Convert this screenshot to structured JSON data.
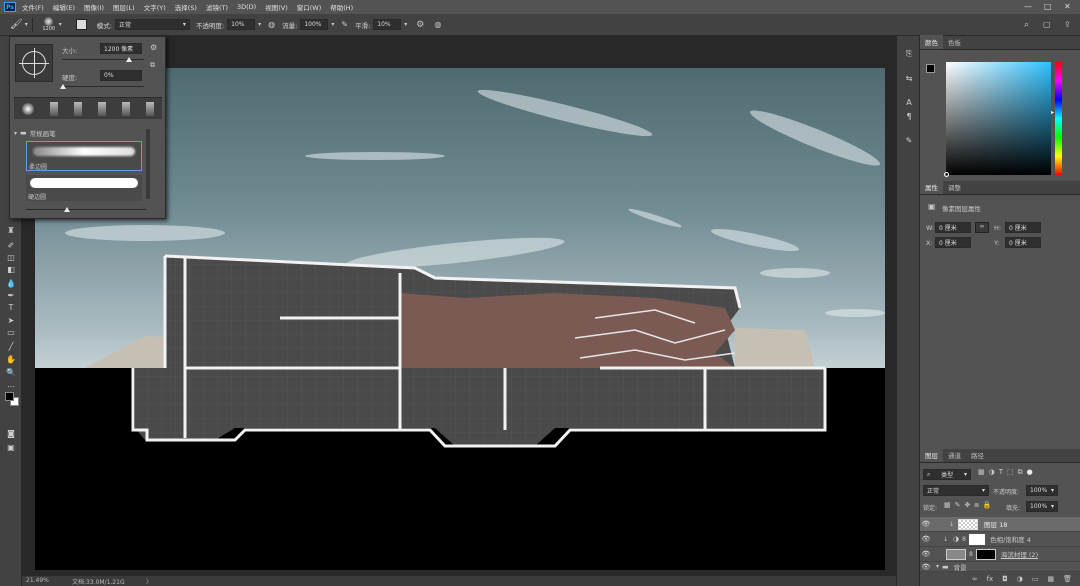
{
  "menu": {
    "items": [
      "文件(F)",
      "编辑(E)",
      "图像(I)",
      "图层(L)",
      "文字(Y)",
      "选择(S)",
      "滤镜(T)",
      "3D(D)",
      "视图(V)",
      "窗口(W)",
      "帮助(H)"
    ]
  },
  "window_controls": {
    "minimize": "—",
    "maximize": "□",
    "close": "✕"
  },
  "options": {
    "brush_size": "1200",
    "mode_label": "模式:",
    "mode_value": "正常",
    "opacity_label": "不透明度:",
    "opacity_value": "10%",
    "flow_label": "流量:",
    "flow_value": "100%",
    "smooth_label": "平滑:",
    "smooth_value": "10%"
  },
  "brush_panel": {
    "size_label": "大小:",
    "size_value": "1200 像素",
    "hardness_label": "硬度:",
    "hardness_value": "0%",
    "group_name": "常规画笔",
    "brush1_name": "柔边圆",
    "brush2_name": "硬边圆"
  },
  "status": {
    "zoom": "21.49%",
    "doc": "文档:33.0M/1.21G",
    "arrow": "〉"
  },
  "color_panel": {
    "tabs": [
      "颜色",
      "色板"
    ]
  },
  "properties": {
    "tabs": [
      "属性",
      "调整"
    ],
    "title": "像素图层属性",
    "w_label": "W:",
    "w_value": "0 厘米",
    "h_label": "H:",
    "h_value": "0 厘米",
    "x_label": "X:",
    "x_value": "0 厘米",
    "y_label": "Y:",
    "y_value": "0 厘米",
    "link_icon_text": "∞"
  },
  "layers_panel": {
    "tabs": [
      "图层",
      "通道",
      "路径"
    ],
    "kind_filter": "类型",
    "blend_mode": "正常",
    "opacity_label": "不透明度:",
    "opacity_value": "100%",
    "lock_label": "锁定:",
    "fill_label": "填充:",
    "fill_value": "100%",
    "layers": [
      {
        "name": "图层 18"
      },
      {
        "name": "色相/饱和度 4"
      },
      {
        "name": "海滨材理 (2)"
      },
      {
        "name": "背景"
      }
    ],
    "bottom_icons": [
      "∞",
      "fx",
      "◘",
      "◑",
      "▭",
      "▦",
      "🗑"
    ]
  },
  "colors": {
    "foreground": "#000000",
    "background": "#ffffff"
  }
}
